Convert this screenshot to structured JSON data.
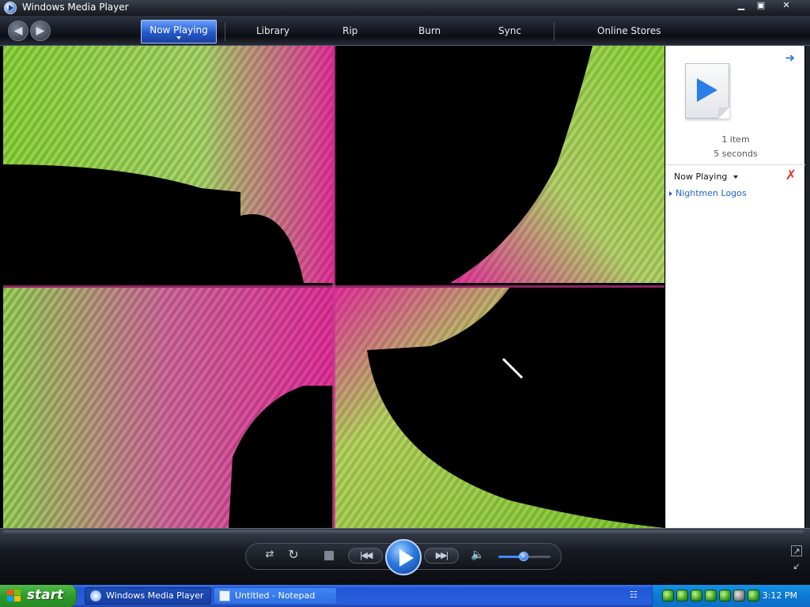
{
  "window": {
    "title": "Windows Media Player",
    "controls": {
      "minimize": "▁",
      "maximize": "▣",
      "close": "✕"
    }
  },
  "nav": {
    "back_icon": "back-arrow-icon",
    "forward_icon": "forward-arrow-icon",
    "tabs": [
      {
        "label": "Now Playing",
        "active": true
      },
      {
        "label": "Library"
      },
      {
        "label": "Rip"
      },
      {
        "label": "Burn"
      },
      {
        "label": "Sync"
      },
      {
        "label": "Online Stores"
      }
    ]
  },
  "visualization": {
    "colors": {
      "green": "#8ed63c",
      "magenta": "#e8329e",
      "background": "#000000"
    }
  },
  "playlist": {
    "item_count": "1 item",
    "duration": "5 seconds",
    "header": "Now Playing",
    "tracks": [
      {
        "title": "Nightmen Logos"
      }
    ]
  },
  "controls": {
    "shuffle_icon": "shuffle-icon",
    "repeat_icon": "repeat-icon",
    "stop_icon": "stop-icon",
    "prev_icon": "previous-icon",
    "play_icon": "play-icon",
    "next_icon": "next-icon",
    "volume_icon": "volume-icon",
    "volume_level": 0.45,
    "accent": "#2d7be0"
  },
  "taskbar": {
    "start_label": "start",
    "tasks": [
      {
        "label": "Windows Media Player",
        "active": true
      },
      {
        "label": "Untitled - Notepad",
        "active": false
      }
    ],
    "clock": "3:12 PM"
  }
}
